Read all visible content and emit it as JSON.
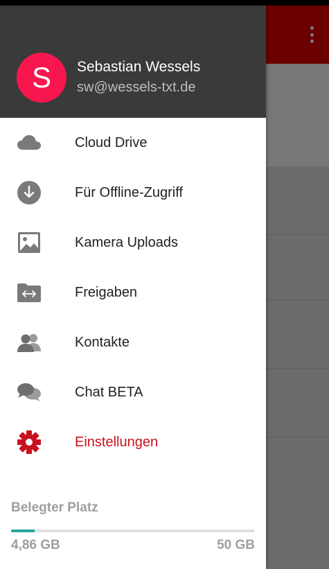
{
  "user": {
    "avatar_letter": "S",
    "name": "Sebastian Wessels",
    "email": "sw@wessels-txt.de"
  },
  "nav": {
    "items": [
      {
        "label": "Cloud Drive",
        "icon": "cloud-icon"
      },
      {
        "label": "Für Offline-Zugriff",
        "icon": "offline-download-icon"
      },
      {
        "label": "Kamera Uploads",
        "icon": "image-icon"
      },
      {
        "label": "Freigaben",
        "icon": "shared-folder-icon"
      },
      {
        "label": "Kontakte",
        "icon": "contacts-icon"
      },
      {
        "label": "Chat BETA",
        "icon": "chat-icon"
      },
      {
        "label": "Einstellungen",
        "icon": "settings-gear-icon"
      }
    ]
  },
  "storage": {
    "title": "Belegter Platz",
    "used": "4,86 GB",
    "total": "50 GB",
    "used_fraction": 0.097
  },
  "colors": {
    "accent": "#c8101e",
    "avatar": "#f8164f",
    "header": "#3a3a3a",
    "storage_fill": "#26a69a"
  }
}
